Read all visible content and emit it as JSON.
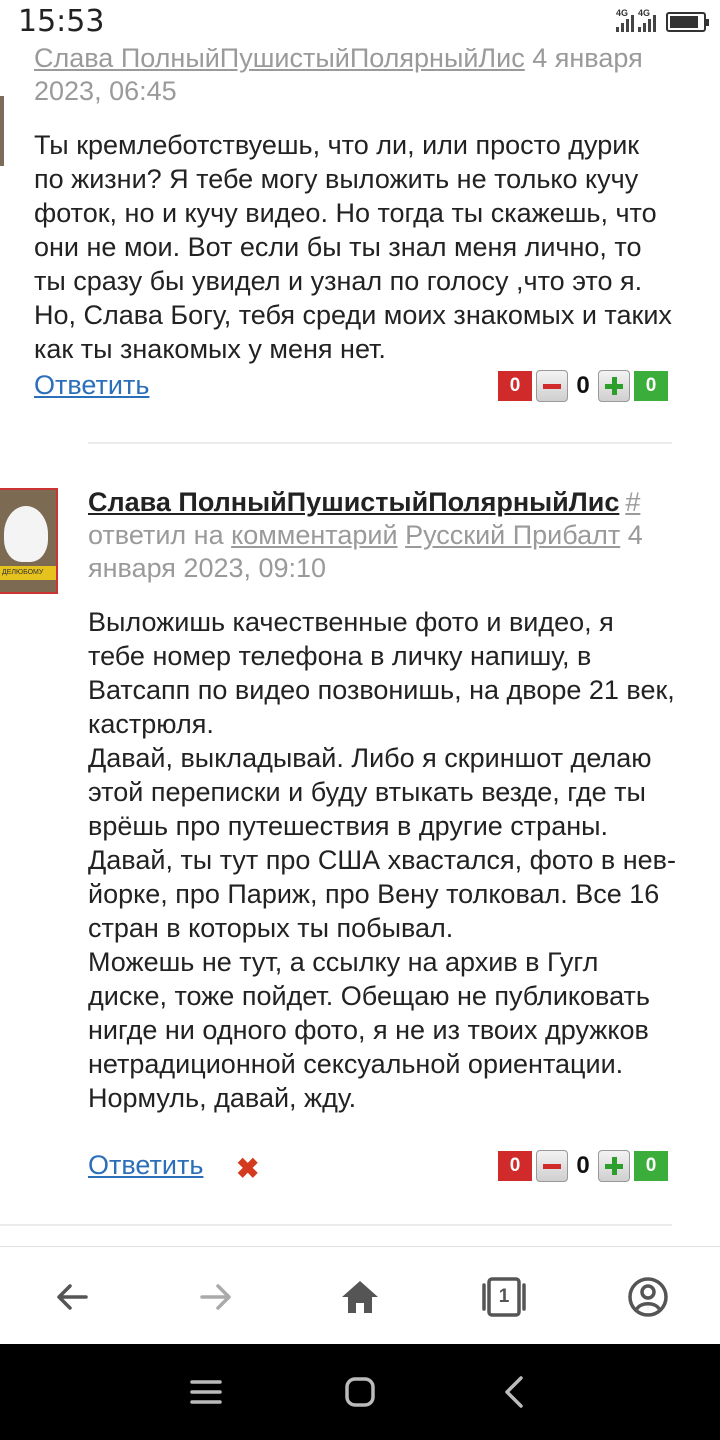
{
  "status_bar": {
    "time": "15:53",
    "network_1": "4G",
    "network_2": "4G",
    "battery_level": 0.78
  },
  "comments": [
    {
      "author": "Слава ПолныйПушистыйПолярныйЛис",
      "date": "4 января 2023, 06:45",
      "text": "Ты кремлеботствуешь, что ли, или просто дурик по жизни? Я тебе могу выложить не только кучу фоток, но и кучу видео. Но тогда ты скажешь, что они не мои. Вот если бы ты знал меня лично, то ты сразу бы увидел и узнал по голосу ,что это я. Но, Слава Богу, тебя среди моих знакомых и таких как ты знакомых у меня нет.",
      "reply_label": "Ответить",
      "votes": {
        "negative": "0",
        "score": "0",
        "positive": "0"
      }
    },
    {
      "author": "Слава ПолныйПушистыйПолярныйЛис",
      "hash": "#",
      "replied_prefix": "ответил на",
      "replied_link": "комментарий",
      "replied_to": "Русский Прибалт",
      "date": "4 января 2023, 09:10",
      "avatar_caption": "ДЕЛЮБОМУ",
      "text": "Выложишь качественные фото и видео, я тебе номер телефона в личку напишу, в Ватсапп по видео позвонишь, на дворе 21 век, кастрюля.\nДавай, выкладывай. Либо я скриншот делаю этой переписки и буду втыкать везде, где ты врёшь про путешествия в другие страны.\nДавай, ты тут про США хвастался, фото в нев-йорке, про Париж, про Вену толковал. Все 16 стран в которых ты побывал.\nМожешь не тут, а ссылку на архив в Гугл диске, тоже пойдет. Обещаю не публиковать нигде ни одного фото, я не из твоих дружков нетрадиционной сексуальной ориентации.\nНормуль, давай, жду.",
      "reply_label": "Ответить",
      "delete_glyph": "✖",
      "votes": {
        "negative": "0",
        "score": "0",
        "positive": "0"
      }
    }
  ],
  "toolbar": {
    "tab_count": "1",
    "icons": [
      "back-arrow-icon",
      "forward-arrow-icon",
      "home-icon",
      "tabs-icon",
      "profile-icon"
    ]
  },
  "navbar": {
    "icons": [
      "menu-icon",
      "home-square-icon",
      "back-chevron-icon"
    ]
  }
}
